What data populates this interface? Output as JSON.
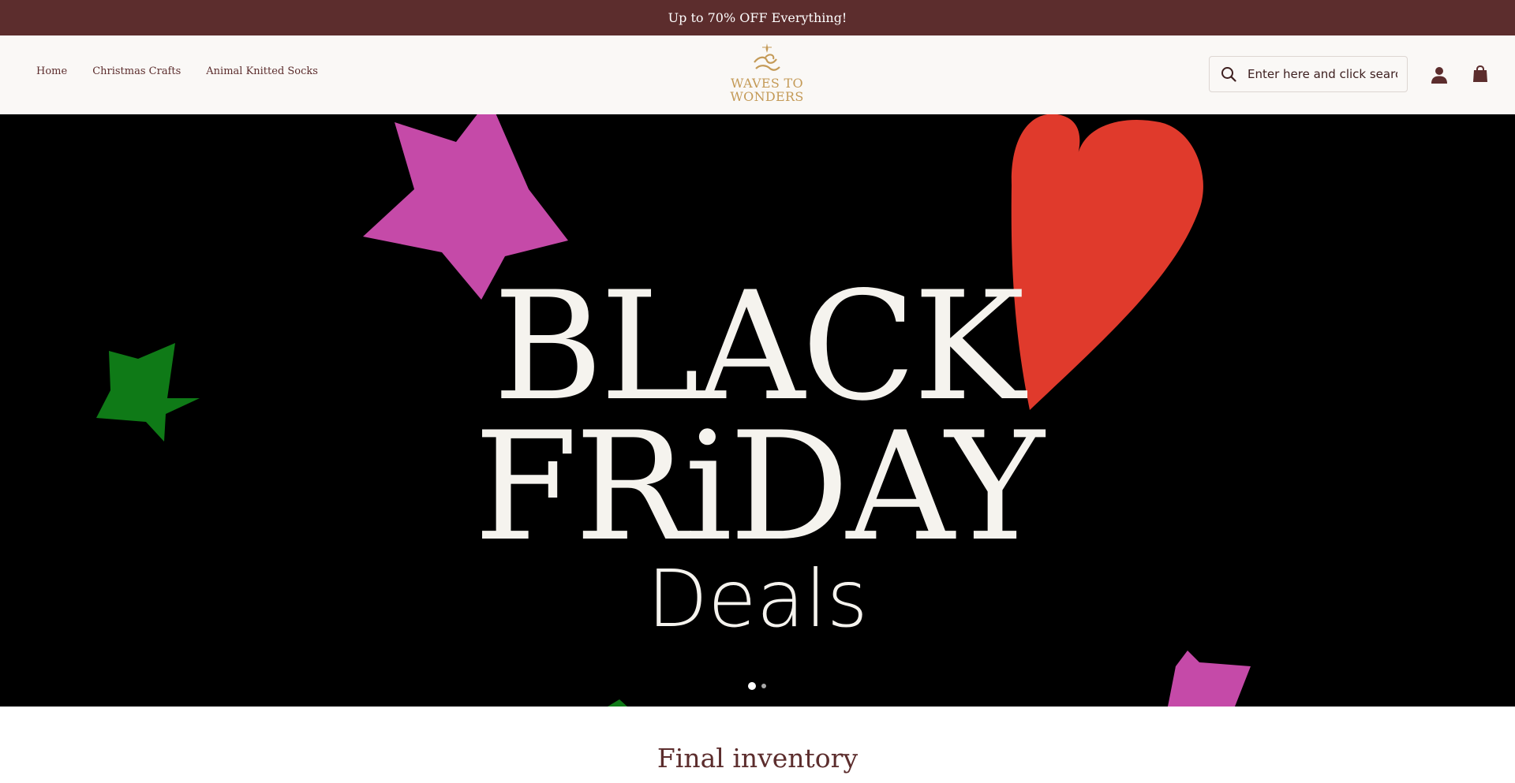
{
  "announcement": {
    "text": "Up to 70% OFF Everything!"
  },
  "nav": {
    "items": [
      {
        "label": "Home"
      },
      {
        "label": "Christmas Crafts"
      },
      {
        "label": "Animal Knitted Socks"
      }
    ]
  },
  "logo": {
    "line1": "WAVES TO",
    "line2": "WONDERS"
  },
  "search": {
    "placeholder": "Enter here and click search"
  },
  "hero": {
    "line1": "BLACK",
    "line2": "FRiDAY",
    "line3": "Deals",
    "slides_total": 2,
    "active_slide": 1
  },
  "section": {
    "title": "Final inventory"
  },
  "colors": {
    "announcement_bg": "#5c2d2d",
    "header_bg": "#faf8f6",
    "brand_text": "#5c2d2d",
    "logo_gold": "#c49a57",
    "hero_bg": "#000000",
    "star_pink": "#c54aa8",
    "star_green": "#0f7a17",
    "heart_red": "#e03a2c"
  },
  "icons": {
    "search": "search-icon",
    "account": "user-icon",
    "cart": "shopping-bag-icon"
  }
}
